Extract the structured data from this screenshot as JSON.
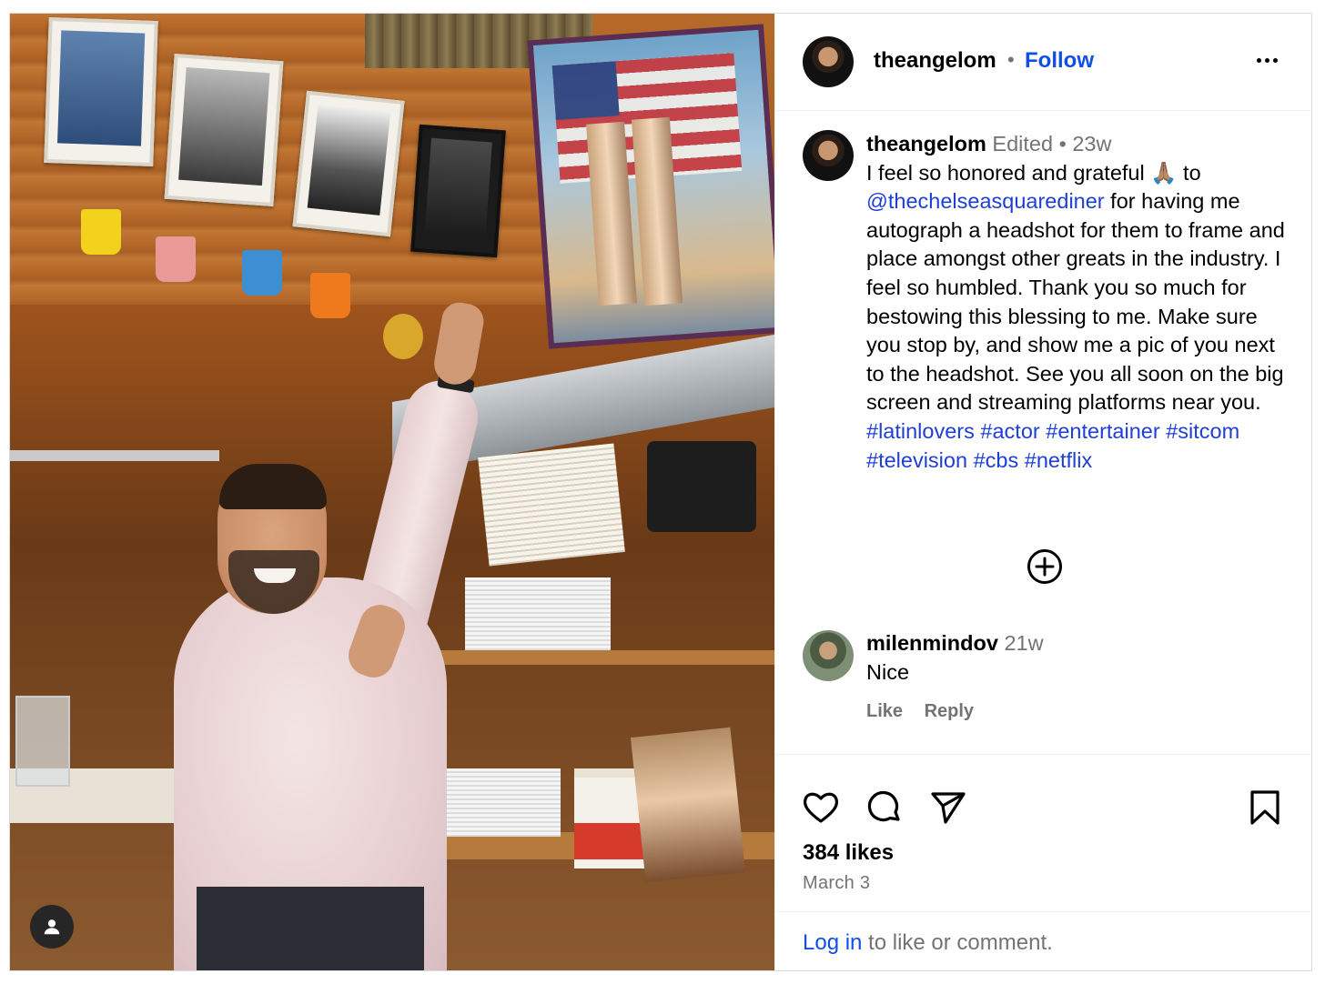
{
  "post": {
    "author": "theangelom",
    "follow_label": "Follow",
    "separator": "•",
    "caption": {
      "username": "theangelom",
      "edited": "Edited",
      "dot": "•",
      "age": "23w",
      "text_1": "I feel so honored and grateful 🙏🏽 to ",
      "mention": "@thechelseasquarediner",
      "text_2": " for having me autograph a headshot for them to frame and place amongst other greats in the industry.  I feel so humbled. Thank you so much for bestowing this blessing to me. Make sure you stop by, and show me a pic of you next to the headshot. See you all soon on the big screen and streaming platforms near you. ",
      "hashtags": [
        "#latinlovers",
        "#actor",
        "#entertainer",
        "#sitcom",
        "#television",
        "#cbs",
        "#netflix"
      ]
    },
    "comments": [
      {
        "username": "milenmindov",
        "age": "21w",
        "text": "Nice",
        "like_label": "Like",
        "reply_label": "Reply"
      }
    ],
    "likes_text": "384 likes",
    "date": "March 3",
    "login": {
      "link": "Log in",
      "rest": " to like or comment."
    }
  },
  "icons": {
    "more": "more-options-icon",
    "add_comment": "add-circle-icon",
    "like": "heart-icon",
    "comment": "comment-bubble-icon",
    "share": "paper-plane-icon",
    "save": "bookmark-icon",
    "tag": "user-tag-icon"
  },
  "colors": {
    "link": "#0f4fe8",
    "hashtag": "#1d3fd6",
    "muted": "#737373",
    "border": "#dbdbdb"
  }
}
